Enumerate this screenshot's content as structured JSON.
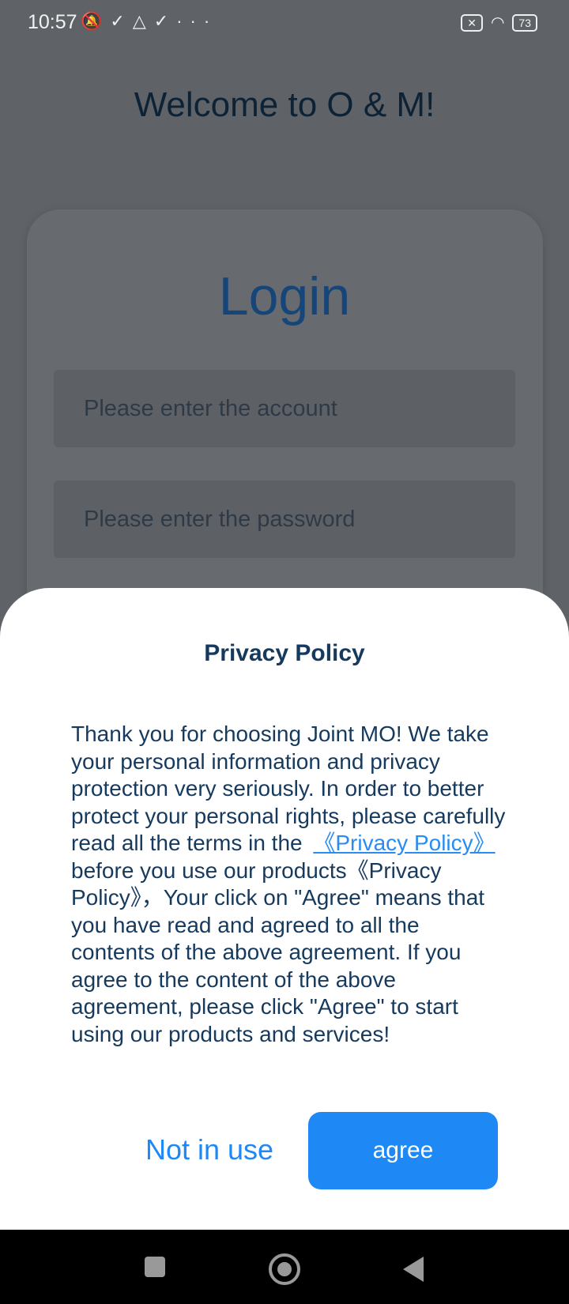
{
  "status_bar": {
    "time": "10:57",
    "battery": "73",
    "icons": [
      "muted-bell-icon",
      "download-done-icon",
      "drive-icon",
      "download-done-icon",
      "more-dots-icon",
      "no-sim-icon",
      "wifi-icon",
      "battery-icon"
    ]
  },
  "welcome": "Welcome to O & M!",
  "login": {
    "title": "Login",
    "account_placeholder": "Please enter the account",
    "password_placeholder": "Please enter the password"
  },
  "dialog": {
    "title": "Privacy Policy",
    "text_before": "Thank you for choosing Joint MO! We take your personal information and privacy protection very seriously. In order to better protect your personal rights, please carefully read all the terms in the",
    "link": "《Privacy Policy》",
    "text_after": "before you use our products《Privacy Policy》，Your click on \"Agree\" means that you have read and agreed to all the contents of the above agreement. If you agree to the content of the above agreement, please click \"Agree\" to start using our products and services!",
    "decline_label": "Not in use",
    "agree_label": "agree",
    "accent": "#1e88f5"
  }
}
